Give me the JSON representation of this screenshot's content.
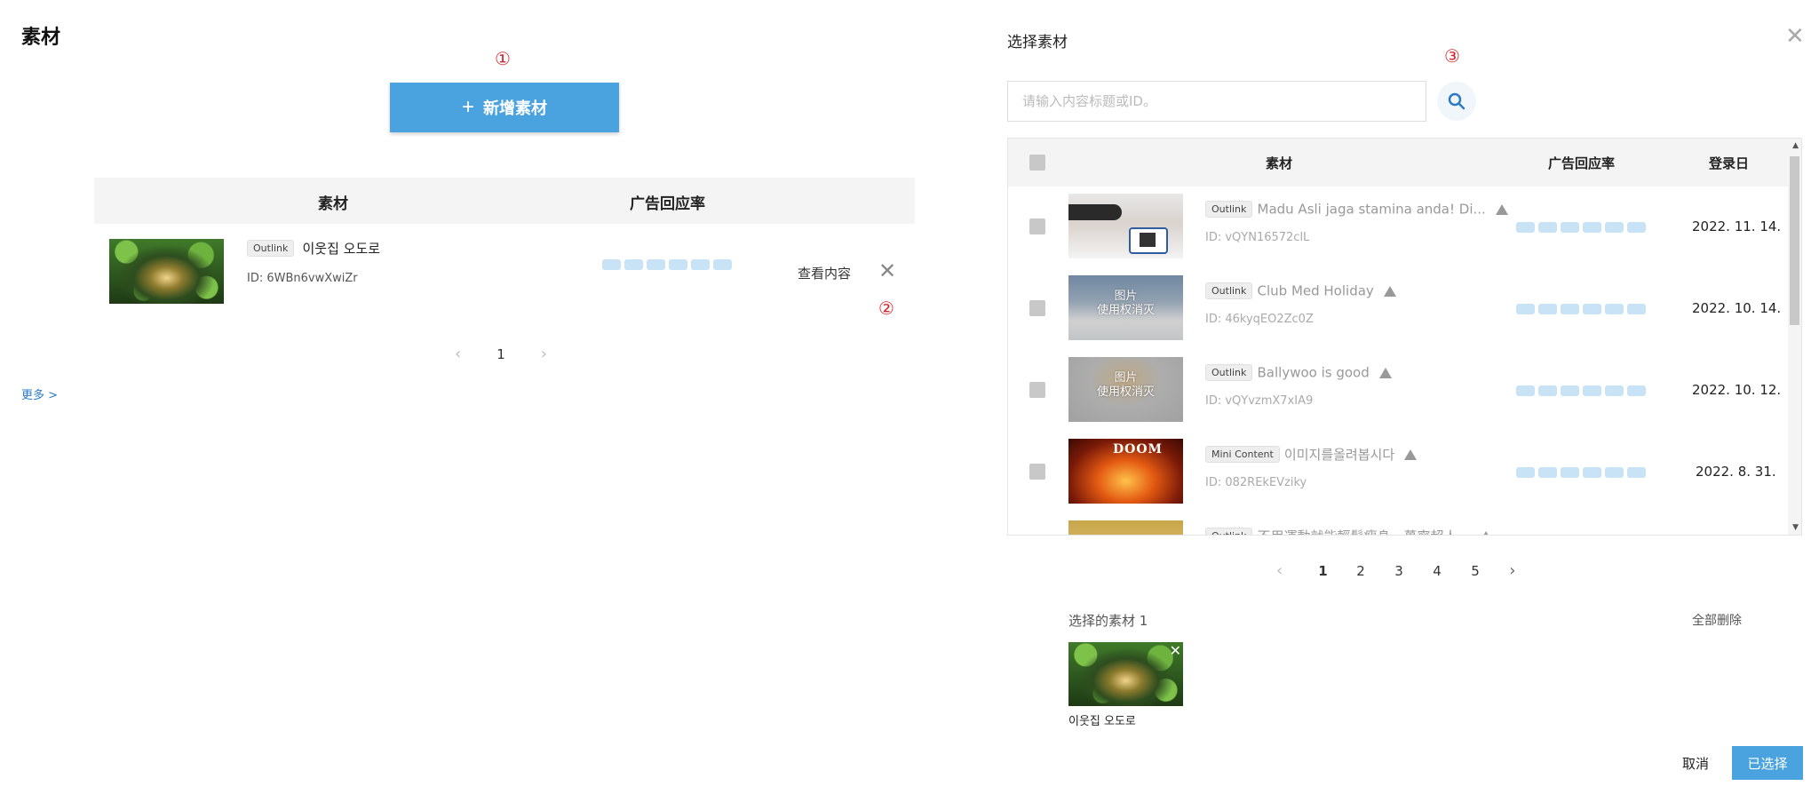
{
  "left": {
    "title": "素材",
    "markers": [
      "①",
      "②",
      "③"
    ],
    "add_button": {
      "icon": "plus-icon",
      "label": "新增素材"
    },
    "table": {
      "headers": [
        "素材",
        "广告回应率"
      ],
      "row": {
        "tag": "Outlink",
        "name": "이웃집 오도로",
        "id": "ID: 6WBn6vwXwiZr",
        "view_label": "查看内容"
      }
    },
    "pagination": {
      "current": "1"
    },
    "more_link": "更多 >"
  },
  "right": {
    "title": "选择素材",
    "search_placeholder": "请输入内容标题或ID。",
    "table": {
      "headers": [
        "素材",
        "广告回应率",
        "登录日"
      ],
      "rows": [
        {
          "tag": "Outlink",
          "title": "Madu Asli jaga stamina anda! Di...",
          "id": "ID: vQYN16572clL",
          "date": "2022. 11. 14."
        },
        {
          "tag": "Outlink",
          "title": "Club Med Holiday",
          "id": "ID: 46kyqEO2Zc0Z",
          "date": "2022. 10. 14.",
          "overlay": "图片\n使用权消灭"
        },
        {
          "tag": "Outlink",
          "title": "Ballywoo is good",
          "id": "ID: vQYvzmX7xIA9",
          "date": "2022. 10. 12.",
          "overlay": "图片\n使用权消灭"
        },
        {
          "tag": "Mini Content",
          "title": "이미지를올려봅시다",
          "id": "ID: 082REkEVziky",
          "date": "2022. 8. 31.",
          "thumb_logo": "DOOM"
        },
        {
          "tag": "Outlink",
          "title": "不用運動就能輕鬆瘦身，萬寧超人...",
          "id": "",
          "date": ""
        }
      ]
    },
    "pagination": {
      "pages": [
        "1",
        "2",
        "3",
        "4",
        "5"
      ],
      "current": "1"
    },
    "selected": {
      "label": "选择的素材 1",
      "delete_all": "全部删除",
      "item_name": "이웃집 오도로"
    },
    "footer": {
      "cancel": "取消",
      "confirm": "已选择"
    }
  },
  "colors": {
    "accent": "#4aa3df",
    "marker": "#d9232e",
    "rate_bar": "#c8e2f6"
  }
}
